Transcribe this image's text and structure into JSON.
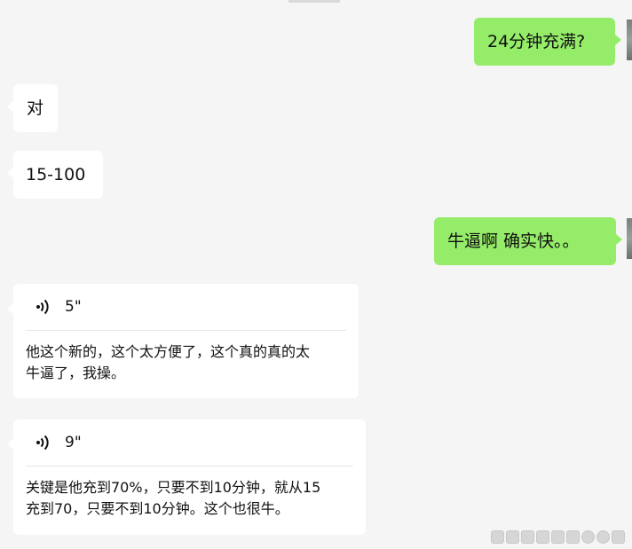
{
  "messages": [
    {
      "id": "m1",
      "direction": "out",
      "type": "text",
      "text": "24分钟充满?"
    },
    {
      "id": "m2",
      "direction": "in",
      "type": "text",
      "text": "对"
    },
    {
      "id": "m3",
      "direction": "in",
      "type": "text",
      "text": "15-100"
    },
    {
      "id": "m4",
      "direction": "out",
      "type": "text",
      "text": "牛逼啊 确实快。。"
    },
    {
      "id": "m5",
      "direction": "in",
      "type": "voice",
      "duration": "5\"",
      "transcript_line1": "他这个新的，这个太方便了，这个真的真的太",
      "transcript_line2": "牛逼了，我操。"
    },
    {
      "id": "m6",
      "direction": "in",
      "type": "voice",
      "duration": "9\"",
      "transcript_line1": "关键是他充到70%，只要不到10分钟，就从15",
      "transcript_line2": "充到70，只要不到10分钟。这个也很牛。"
    }
  ],
  "icons": {
    "voice": "voice-wave-icon",
    "bottom_strip": [
      "window-icon",
      "window-icon",
      "window-icon",
      "window-icon",
      "window-icon",
      "window-icon",
      "window-icon",
      "window-icon",
      "window-icon"
    ]
  },
  "colors": {
    "background": "#f5f5f5",
    "incoming_bubble": "#ffffff",
    "outgoing_bubble": "#95ec69"
  }
}
